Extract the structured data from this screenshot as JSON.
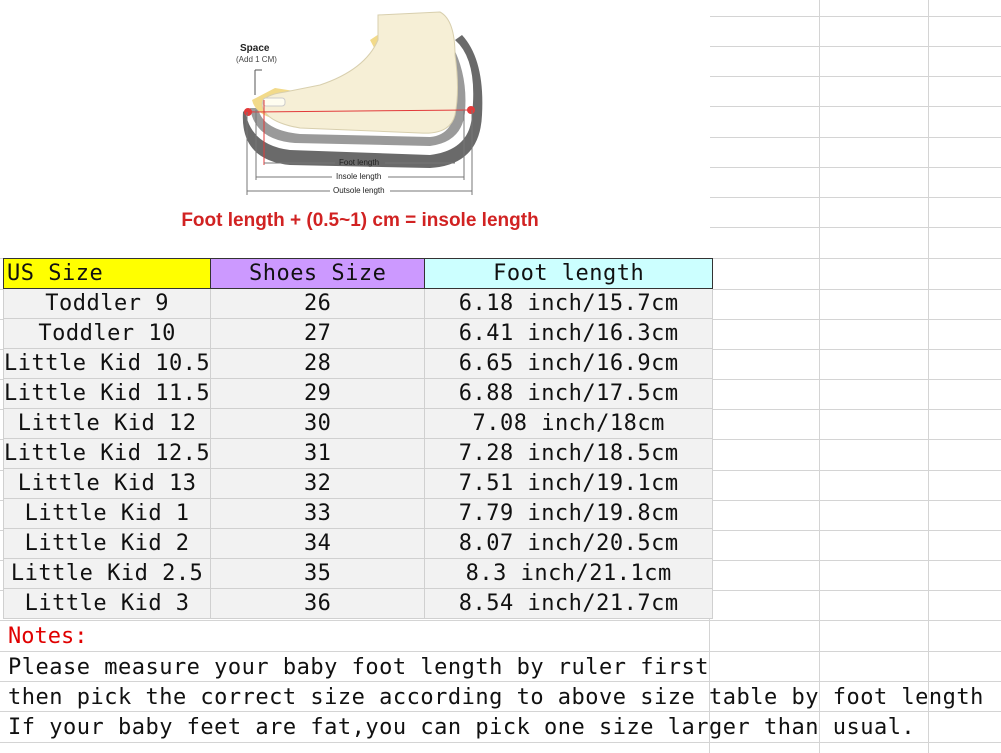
{
  "diagram": {
    "space_label": "Space",
    "space_sub_label": "(Add 1 CM)",
    "foot_length_label": "Foot length",
    "insole_length_label": "Insole length",
    "outsole_length_label": "Outsole length",
    "icon": "foot-in-shoe-diagram"
  },
  "caption": "Foot length + (0.5~1) cm = insole length",
  "table": {
    "headers": {
      "us_size": "US Size",
      "shoes_size": "Shoes Size",
      "foot_length": "Foot length"
    },
    "rows": [
      {
        "us": "Toddler 9",
        "shoes": "26",
        "foot": "6.18 inch/15.7cm"
      },
      {
        "us": "Toddler 10",
        "shoes": "27",
        "foot": "6.41 inch/16.3cm"
      },
      {
        "us": "Little Kid 10.5",
        "shoes": "28",
        "foot": "6.65 inch/16.9cm"
      },
      {
        "us": "Little Kid 11.5",
        "shoes": "29",
        "foot": "6.88 inch/17.5cm"
      },
      {
        "us": "Little Kid 12",
        "shoes": "30",
        "foot": "7.08 inch/18cm"
      },
      {
        "us": "Little Kid 12.5",
        "shoes": "31",
        "foot": "7.28 inch/18.5cm"
      },
      {
        "us": "Little Kid 13",
        "shoes": "32",
        "foot": "7.51 inch/19.1cm"
      },
      {
        "us": "Little Kid 1",
        "shoes": "33",
        "foot": "7.79 inch/19.8cm"
      },
      {
        "us": "Little Kid 2",
        "shoes": "34",
        "foot": "8.07 inch/20.5cm"
      },
      {
        "us": "Little Kid 2.5",
        "shoes": "35",
        "foot": "8.3 inch/21.1cm"
      },
      {
        "us": "Little Kid 3",
        "shoes": "36",
        "foot": "8.54 inch/21.7cm"
      }
    ]
  },
  "notes": {
    "title": "Notes:",
    "lines": [
      "Please measure your baby foot length by ruler first",
      "then pick the correct size according to above size table by foot length",
      "If your baby feet are fat,you can pick one size larger than usual."
    ]
  },
  "colors": {
    "us_header_bg": "#ffff00",
    "shoes_header_bg": "#cc99ff",
    "foot_header_bg": "#ccffff",
    "caption": "#d12222",
    "notes_title": "#e00000"
  }
}
